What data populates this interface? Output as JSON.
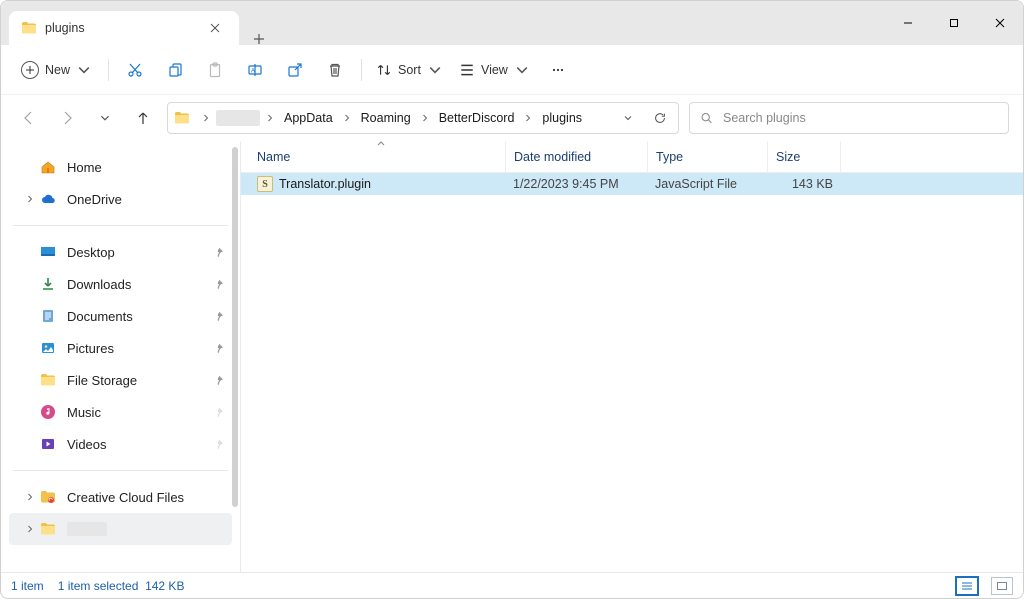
{
  "window": {
    "tab_title": "plugins"
  },
  "toolbar": {
    "new_label": "New",
    "sort_label": "Sort",
    "view_label": "View"
  },
  "breadcrumbs": {
    "items": [
      "",
      "AppData",
      "Roaming",
      "BetterDiscord",
      "plugins"
    ]
  },
  "search": {
    "placeholder": "Search plugins"
  },
  "sidebar": {
    "home": "Home",
    "onedrive": "OneDrive",
    "quick": [
      {
        "label": "Desktop",
        "pinned": true
      },
      {
        "label": "Downloads",
        "pinned": true
      },
      {
        "label": "Documents",
        "pinned": true
      },
      {
        "label": "Pictures",
        "pinned": true
      },
      {
        "label": "File Storage",
        "pinned": true
      },
      {
        "label": "Music",
        "pinned": false
      },
      {
        "label": "Videos",
        "pinned": false
      }
    ],
    "bottom": {
      "creative": "Creative Cloud Files"
    }
  },
  "columns": {
    "name": "Name",
    "date": "Date modified",
    "type": "Type",
    "size": "Size"
  },
  "files": [
    {
      "name": "Translator.plugin",
      "date": "1/22/2023 9:45 PM",
      "type": "JavaScript File",
      "size": "143 KB",
      "selected": true
    }
  ],
  "status": {
    "count": "1 item",
    "selection": "1 item selected",
    "selsize": "142 KB"
  }
}
